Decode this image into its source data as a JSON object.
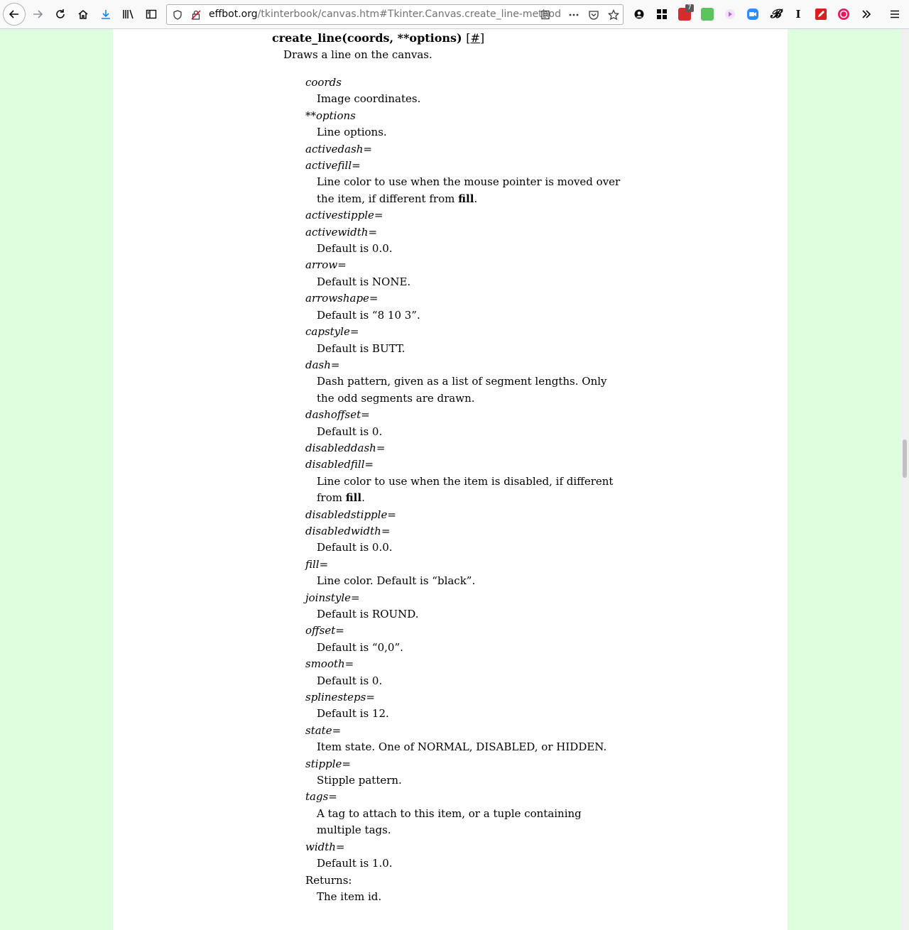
{
  "browser": {
    "url_host": "effbot.org",
    "url_path": "/tkinterbook/canvas.htm#Tkinter.Canvas.create_line-method",
    "extension_badge": "7",
    "colors": {
      "toolbar_bg": "#f9f9fa",
      "download_icon": "#0a84ff",
      "page_margin": "#ddffdd"
    }
  },
  "page": {
    "method_title": "create_line(coords, **options)",
    "anchor_open": "[",
    "anchor_link": "#",
    "anchor_close": "]",
    "description": "Draws a line on the canvas.",
    "options": [
      {
        "name": "coords",
        "desc": "Image coordinates."
      },
      {
        "name": "**options",
        "desc": "Line options."
      },
      {
        "name": "activedash="
      },
      {
        "name": "activefill=",
        "desc": "Line color to use when the mouse pointer is moved over the item, if different from ",
        "bold": "fill",
        "tail": "."
      },
      {
        "name": "activestipple="
      },
      {
        "name": "activewidth=",
        "desc": "Default is 0.0."
      },
      {
        "name": "arrow=",
        "desc": "Default is NONE."
      },
      {
        "name": "arrowshape=",
        "desc": "Default is “8 10 3”."
      },
      {
        "name": "capstyle=",
        "desc": "Default is BUTT."
      },
      {
        "name": "dash=",
        "desc": "Dash pattern, given as a list of segment lengths. Only the odd segments are drawn."
      },
      {
        "name": "dashoffset=",
        "desc": "Default is 0."
      },
      {
        "name": "disableddash="
      },
      {
        "name": "disabledfill=",
        "desc": "Line color to use when the item is disabled, if different from ",
        "bold": "fill",
        "tail": "."
      },
      {
        "name": "disabledstipple="
      },
      {
        "name": "disabledwidth=",
        "desc": "Default is 0.0."
      },
      {
        "name": "fill=",
        "desc": "Line color. Default is “black”."
      },
      {
        "name": "joinstyle=",
        "desc": "Default is ROUND."
      },
      {
        "name": "offset=",
        "desc": "Default is “0,0”."
      },
      {
        "name": "smooth=",
        "desc": "Default is 0."
      },
      {
        "name": "splinesteps=",
        "desc": "Default is 12."
      },
      {
        "name": "state=",
        "desc": "Item state. One of NORMAL, DISABLED, or HIDDEN."
      },
      {
        "name": "stipple=",
        "desc": "Stipple pattern."
      },
      {
        "name": "tags=",
        "desc": "A tag to attach to this item, or a tuple containing multiple tags."
      },
      {
        "name": "width=",
        "desc": "Default is 1.0."
      }
    ],
    "returns_label": "Returns:",
    "returns_desc": "The item id."
  }
}
